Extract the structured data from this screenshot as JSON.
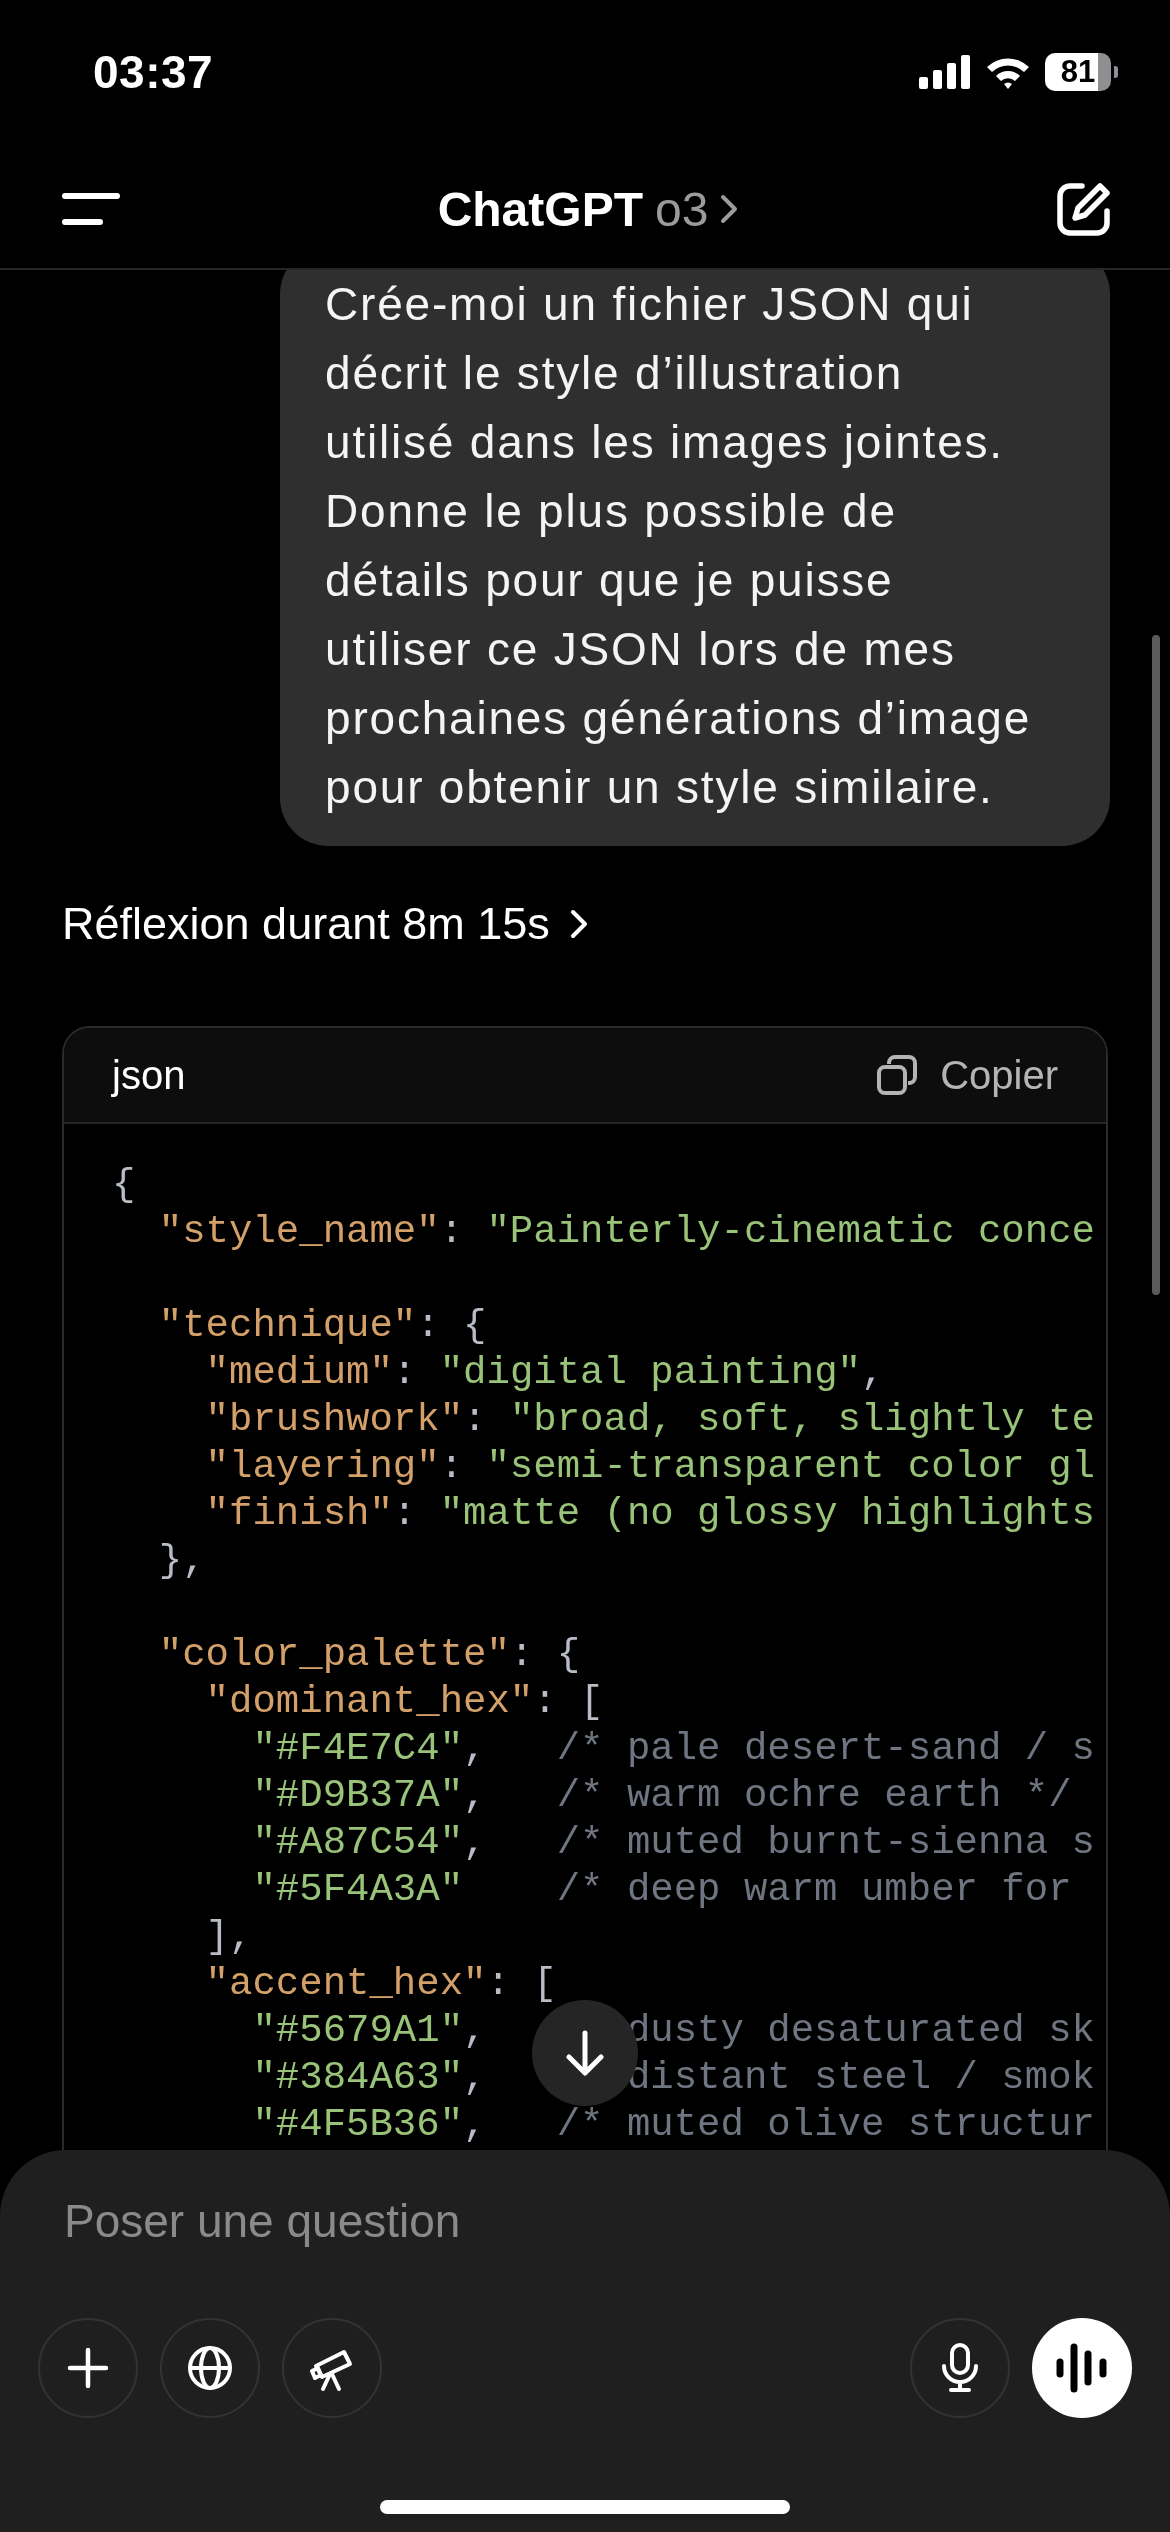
{
  "status_bar": {
    "time": "03:37",
    "battery": "81"
  },
  "header": {
    "title": "ChatGPT",
    "model": "o3"
  },
  "message": {
    "text": "Crée-moi un fichier JSON qui décrit le style d’illustration utilisé dans les images jointes. Donne le plus possible de détails pour que je puisse utiliser ce JSON lors de mes prochaines générations d’image pour obtenir un style similaire."
  },
  "reasoning": {
    "label": "Réflexion durant 8m 15s"
  },
  "code_block": {
    "language": "json",
    "copy_label": "Copier",
    "lines": [
      {
        "kind": "code",
        "tokens": [
          {
            "kind": "punct",
            "text": "{"
          }
        ]
      },
      {
        "kind": "code",
        "tokens": [
          {
            "kind": "key",
            "text": "  \"style_name\""
          },
          {
            "kind": "punct",
            "text": ": "
          },
          {
            "kind": "string",
            "text": "\"Painterly-cinematic conce"
          }
        ]
      },
      {
        "kind": "blank"
      },
      {
        "kind": "code",
        "tokens": [
          {
            "kind": "key",
            "text": "  \"technique\""
          },
          {
            "kind": "punct",
            "text": ": {"
          }
        ]
      },
      {
        "kind": "code",
        "tokens": [
          {
            "kind": "key",
            "text": "    \"medium\""
          },
          {
            "kind": "punct",
            "text": ": "
          },
          {
            "kind": "string",
            "text": "\"digital painting\""
          },
          {
            "kind": "punct",
            "text": ","
          }
        ]
      },
      {
        "kind": "code",
        "tokens": [
          {
            "kind": "key",
            "text": "    \"brushwork\""
          },
          {
            "kind": "punct",
            "text": ": "
          },
          {
            "kind": "string",
            "text": "\"broad, soft, slightly te"
          }
        ]
      },
      {
        "kind": "code",
        "tokens": [
          {
            "kind": "key",
            "text": "    \"layering\""
          },
          {
            "kind": "punct",
            "text": ": "
          },
          {
            "kind": "string",
            "text": "\"semi-transparent color gl"
          }
        ]
      },
      {
        "kind": "code",
        "tokens": [
          {
            "kind": "key",
            "text": "    \"finish\""
          },
          {
            "kind": "punct",
            "text": ": "
          },
          {
            "kind": "string",
            "text": "\"matte (no glossy highlights"
          }
        ]
      },
      {
        "kind": "code",
        "tokens": [
          {
            "kind": "punct",
            "text": "  },"
          }
        ]
      },
      {
        "kind": "blank"
      },
      {
        "kind": "code",
        "tokens": [
          {
            "kind": "key",
            "text": "  \"color_palette\""
          },
          {
            "kind": "punct",
            "text": ": {"
          }
        ]
      },
      {
        "kind": "code",
        "tokens": [
          {
            "kind": "key",
            "text": "    \"dominant_hex\""
          },
          {
            "kind": "punct",
            "text": ": ["
          }
        ]
      },
      {
        "kind": "code",
        "tokens": [
          {
            "kind": "string",
            "text": "      \"#F4E7C4\""
          },
          {
            "kind": "punct",
            "text": ",   "
          },
          {
            "kind": "comment",
            "text": "/* pale desert-sand / s"
          }
        ]
      },
      {
        "kind": "code",
        "tokens": [
          {
            "kind": "string",
            "text": "      \"#D9B37A\""
          },
          {
            "kind": "punct",
            "text": ",   "
          },
          {
            "kind": "comment",
            "text": "/* warm ochre earth */"
          }
        ]
      },
      {
        "kind": "code",
        "tokens": [
          {
            "kind": "string",
            "text": "      \"#A87C54\""
          },
          {
            "kind": "punct",
            "text": ",   "
          },
          {
            "kind": "comment",
            "text": "/* muted burnt-sienna s"
          }
        ]
      },
      {
        "kind": "code",
        "tokens": [
          {
            "kind": "string",
            "text": "      \"#5F4A3A\""
          },
          {
            "kind": "comment",
            "text": "    /* deep warm umber for"
          }
        ]
      },
      {
        "kind": "code",
        "tokens": [
          {
            "kind": "punct",
            "text": "    ],"
          }
        ]
      },
      {
        "kind": "code",
        "tokens": [
          {
            "kind": "key",
            "text": "    \"accent_hex\""
          },
          {
            "kind": "punct",
            "text": ": ["
          }
        ]
      },
      {
        "kind": "code",
        "tokens": [
          {
            "kind": "string",
            "text": "      \"#5679A1\""
          },
          {
            "kind": "punct",
            "text": ",      "
          },
          {
            "kind": "comment",
            "text": "dusty desaturated sk"
          }
        ]
      },
      {
        "kind": "code",
        "tokens": [
          {
            "kind": "string",
            "text": "      \"#384A63\""
          },
          {
            "kind": "punct",
            "text": ",      "
          },
          {
            "kind": "comment",
            "text": "distant steel / smok"
          }
        ]
      },
      {
        "kind": "code",
        "tokens": [
          {
            "kind": "string",
            "text": "      \"#4F5B36\""
          },
          {
            "kind": "punct",
            "text": ",   "
          },
          {
            "kind": "comment",
            "text": "/* muted olive structur"
          }
        ]
      }
    ]
  },
  "composer": {
    "placeholder": "Poser une question"
  }
}
